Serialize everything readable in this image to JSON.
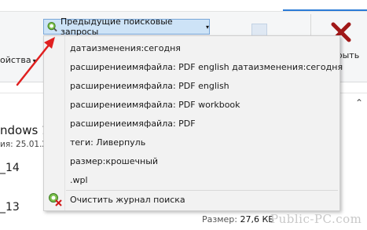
{
  "ribbon": {
    "properties_label": "ойства",
    "recent_searches_label": "Предыдущие поисковые запросы",
    "close_search_label": "крыть"
  },
  "dropdown": {
    "items": [
      "датаизменения:сегодня",
      "расширениеимяфайла: PDF english датаизменения:сегодня",
      "расширениеимяфайла: PDF english",
      "расширениеимяфайла: PDF workbook",
      "расширениеимяфайла: PDF",
      "теги: Ливерпуль",
      "размер:крошечный",
      ".wpl"
    ],
    "clear_label": "Очистить журнал поиска"
  },
  "file_list": {
    "windows_text": "ndows 1",
    "date_text": "ия: 25.01.2",
    "file_14": "_14",
    "file_13": "_13"
  },
  "status": {
    "size_label": "Размер:",
    "size_value": "27,6 КБ"
  },
  "watermark": "Public-PC.com",
  "colors": {
    "accent": "#2b7bd6",
    "button_bg": "#cde3f7",
    "arrow": "#e02020",
    "close_x": "#a01818"
  }
}
